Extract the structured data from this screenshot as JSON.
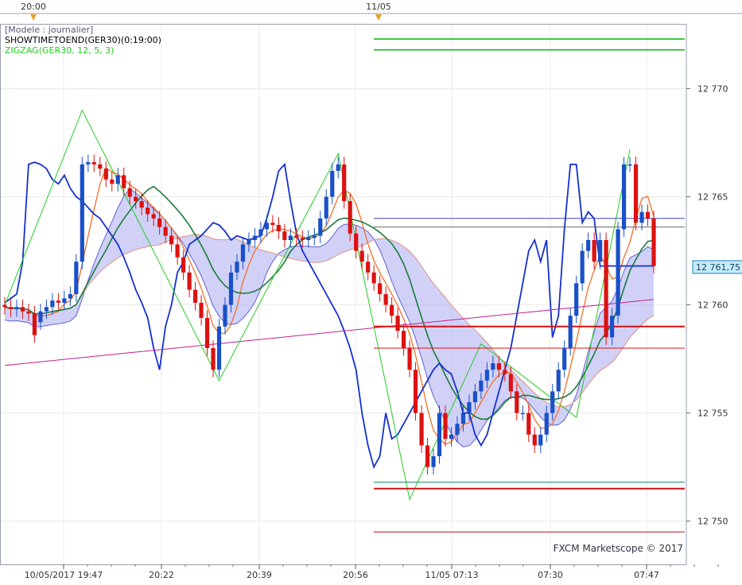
{
  "legend": {
    "title": "[Modele : journalier]",
    "indicator1": "SHOWTIMETOEND(GER30)(0:19:00)",
    "indicator2": "ZIGZAG(GER30, 12, 5, 3)"
  },
  "credit": "FXCM Marketscope © 2017",
  "chart_data": {
    "type": "candlestick",
    "symbol": "GER30",
    "interval_minutes": 1,
    "y_range": [
      12748,
      12773
    ],
    "y_ticks": [
      12770,
      12765,
      12760,
      12755,
      12750
    ],
    "y_tick_labels": [
      "12 770",
      "12 765",
      "12 760",
      "12 755",
      "12 750"
    ],
    "x_tick_labels": [
      "10/05/2017 19:47",
      "20:22",
      "20:39",
      "20:56",
      "11/05 07:13",
      "07:30",
      "07:47"
    ],
    "top_axis_labels": [
      "20:00",
      "11/05"
    ],
    "current_price": 12761.75,
    "current_price_label": "12 761,75",
    "grid": true,
    "colors": {
      "up": "#1a50c8",
      "down": "#dd1111",
      "grid": "#e6e6e6"
    },
    "candles_o": [
      12760.0,
      12759.9,
      12759.8,
      12759.9,
      12759.7,
      12759.6,
      12759.2,
      12759.7,
      12759.9,
      12760.2,
      12760.1,
      12760.3,
      12760.5,
      12762.0,
      12766.5,
      12766.6,
      12766.5,
      12766.3,
      12765.8,
      12765.6,
      12766.0,
      12765.4,
      12765.0,
      12764.8,
      12764.5,
      12764.2,
      12764.0,
      12763.6,
      12763.2,
      12762.8,
      12762.2,
      12761.5,
      12760.7,
      12760.1,
      12759.4,
      12758.0,
      12757.0,
      12759.0,
      12760.0,
      12761.5,
      12762.0,
      12762.8,
      12763.0,
      12763.2,
      12763.5,
      12763.8,
      12763.7,
      12763.4,
      12763.0,
      12763.2,
      12763.1,
      12763.0,
      12763.1,
      12763.2,
      12764.0,
      12765.0,
      12766.2,
      12766.5,
      12764.8,
      12763.3,
      12762.5,
      12762.0,
      12761.5,
      12761.0,
      12760.5,
      12760.0,
      12759.5,
      12758.8,
      12758.0,
      12757.0,
      12755.0,
      12753.5,
      12752.5,
      12753.0,
      12755.0,
      12753.8,
      12754.0,
      12754.5,
      12755.0,
      12755.5,
      12756.0,
      12756.5,
      12757.0,
      12757.3,
      12757.0,
      12756.8,
      12756.0,
      12755.0,
      12755.0,
      12754.0,
      12753.5,
      12754.0,
      12755.0,
      12756.0,
      12757.0,
      12758.0,
      12759.5,
      12761.0,
      12762.5,
      12763.0,
      12762.0,
      12763.0,
      12758.5,
      12759.5,
      12763.5,
      12766.5,
      12766.5,
      12763.8,
      12764.3,
      12764.0
    ],
    "candles_c": [
      12759.9,
      12759.8,
      12759.9,
      12759.7,
      12759.6,
      12758.6,
      12759.7,
      12759.9,
      12760.2,
      12760.1,
      12760.3,
      12760.5,
      12762.0,
      12766.5,
      12766.6,
      12766.5,
      12766.3,
      12765.8,
      12765.6,
      12766.0,
      12765.4,
      12765.0,
      12764.8,
      12764.5,
      12764.2,
      12764.0,
      12763.6,
      12763.2,
      12762.8,
      12762.2,
      12761.5,
      12760.7,
      12760.1,
      12759.4,
      12758.0,
      12757.0,
      12759.0,
      12760.0,
      12761.5,
      12762.0,
      12762.8,
      12763.0,
      12763.2,
      12763.5,
      12763.8,
      12763.7,
      12763.4,
      12763.0,
      12763.2,
      12763.1,
      12763.0,
      12763.1,
      12763.2,
      12764.0,
      12765.0,
      12766.2,
      12766.5,
      12764.8,
      12763.3,
      12762.5,
      12762.0,
      12761.5,
      12761.0,
      12760.5,
      12760.0,
      12759.5,
      12758.8,
      12758.0,
      12757.0,
      12755.0,
      12753.5,
      12752.5,
      12753.0,
      12755.0,
      12753.8,
      12754.0,
      12754.5,
      12755.0,
      12755.5,
      12756.0,
      12756.5,
      12757.0,
      12757.3,
      12757.0,
      12756.8,
      12756.0,
      12755.0,
      12755.0,
      12754.0,
      12753.5,
      12754.0,
      12755.0,
      12756.0,
      12757.0,
      12758.0,
      12759.5,
      12761.0,
      12762.5,
      12763.0,
      12762.0,
      12763.0,
      12758.5,
      12759.5,
      12763.5,
      12766.5,
      12766.5,
      12763.8,
      12764.3,
      12764.0,
      12761.8
    ]
  }
}
